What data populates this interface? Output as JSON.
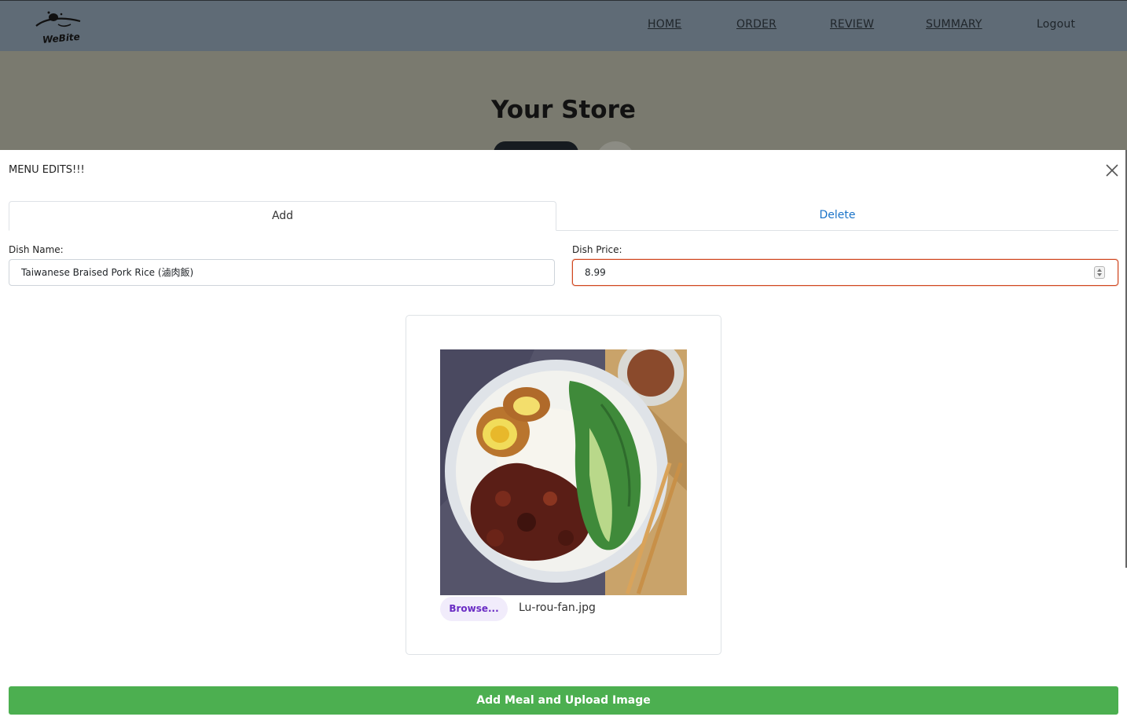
{
  "header": {
    "logo_text": "WeBite",
    "nav": [
      "HOME",
      "ORDER",
      "REVIEW",
      "SUMMARY"
    ],
    "logout_label": "Logout"
  },
  "background": {
    "page_title": "Your Store"
  },
  "modal": {
    "title": "MENU EDITS!!!",
    "tabs": [
      {
        "label": "Add",
        "active": true
      },
      {
        "label": "Delete",
        "active": false
      }
    ],
    "dish_name_label": "Dish Name:",
    "dish_name_value": "Taiwanese Braised Pork Rice (滷肉飯)",
    "dish_price_label": "Dish Price:",
    "dish_price_value": "8.99",
    "browse_label": "Browse...",
    "file_name": "Lu-rou-fan.jpg",
    "submit_label": "Add Meal and Upload Image"
  },
  "colors": {
    "navbar": "#5f6b76",
    "overlay": "#7a7a6f",
    "submit": "#4caf50",
    "tab_link": "#1a73c8",
    "price_border": "#d0461f",
    "browse_text": "#6a2cc4"
  }
}
